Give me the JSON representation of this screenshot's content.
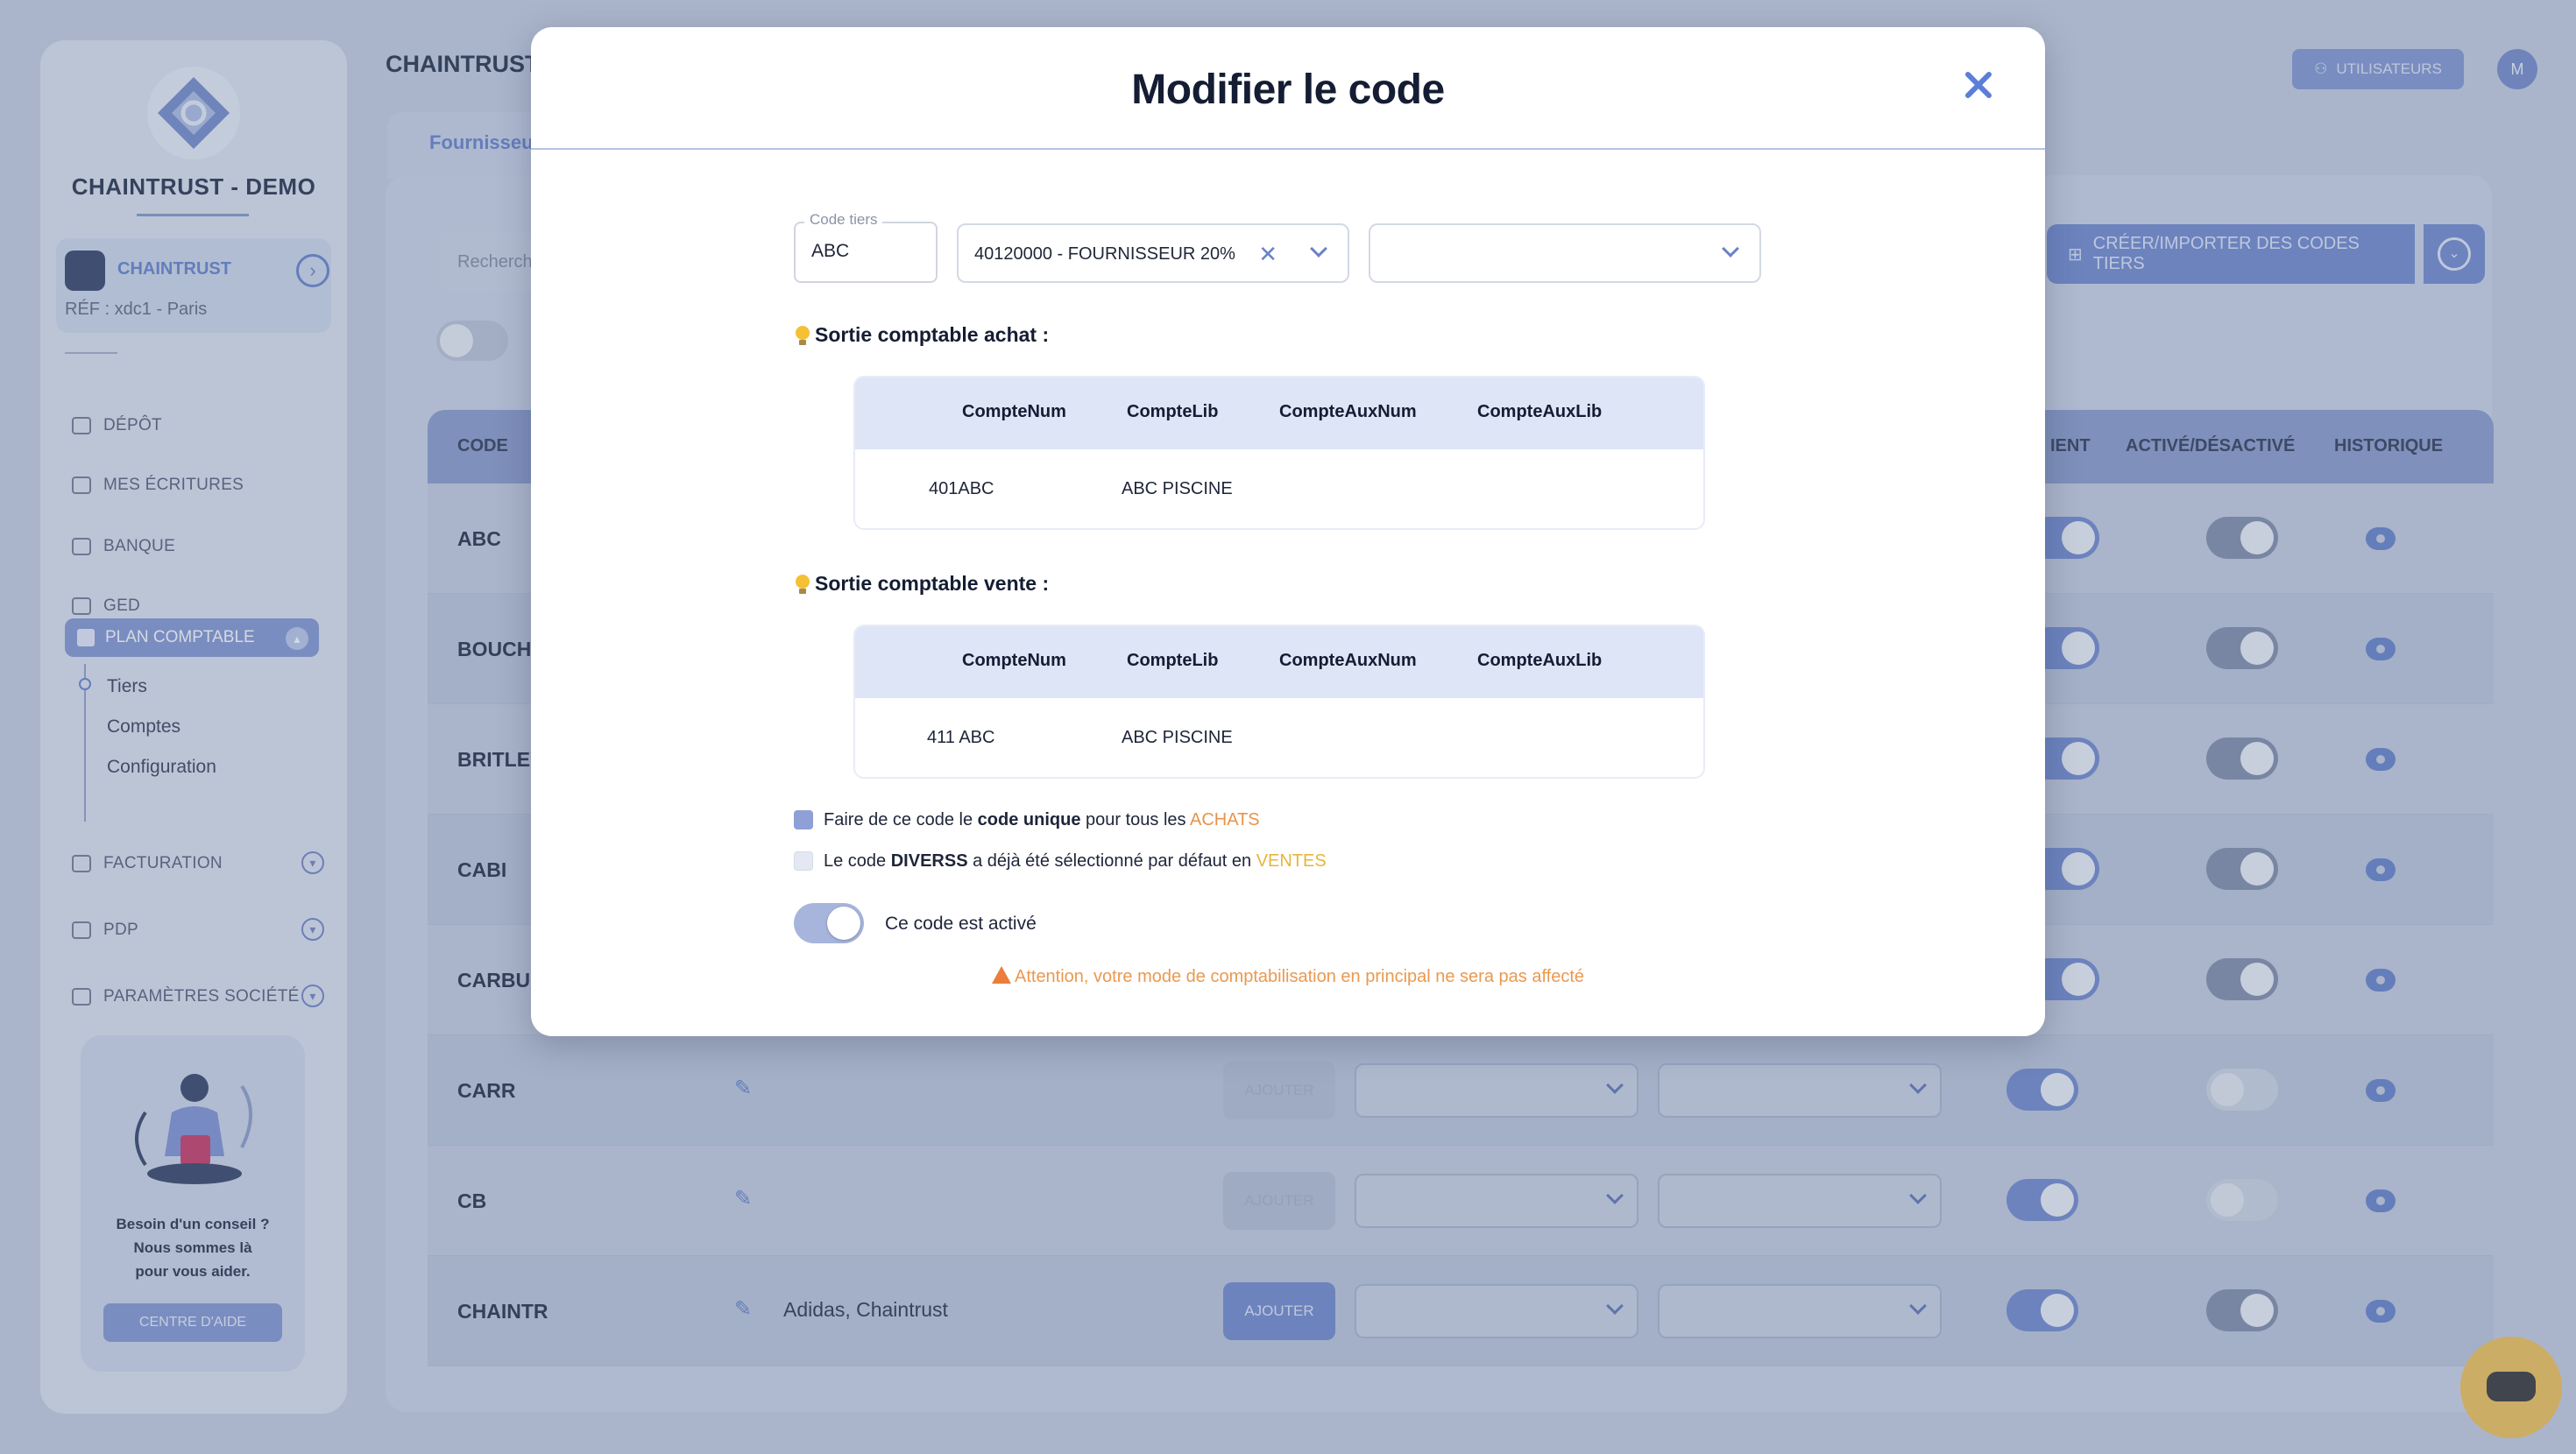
{
  "app": {
    "brand": "CHAINTRUST - DEMO",
    "org_name": "CHAINTRUST",
    "org_ref": "RÉF : xdc1 - Paris",
    "page_title": "CHAINTRUST",
    "top_button": "UTILISATEURS",
    "avatar_initial": "M",
    "tab_label": "Fournisseu",
    "search_placeholder": "Recherch",
    "create_button": "CRÉER/IMPORTER DES CODES TIERS",
    "colors": {
      "accent": "#6b84cc",
      "warning": "#ea9950",
      "achats": "#e8944a",
      "ventes": "#e6b53c"
    }
  },
  "sidebar": {
    "items": [
      {
        "label": "DÉPÔT",
        "icon": "folder-icon"
      },
      {
        "label": "MES ÉCRITURES",
        "icon": "folder-icon"
      },
      {
        "label": "BANQUE",
        "icon": "bank-icon"
      },
      {
        "label": "GED",
        "icon": "document-icon"
      }
    ],
    "active": {
      "label": "PLAN COMPTABLE",
      "icon": "ledger-icon"
    },
    "sub_items": [
      "Tiers",
      "Comptes",
      "Configuration"
    ],
    "more_items": [
      {
        "label": "FACTURATION",
        "icon": "invoice-icon"
      },
      {
        "label": "PDP",
        "icon": "card-icon"
      },
      {
        "label": "PARAMÈTRES SOCIÉTÉ",
        "icon": "sliders-icon"
      }
    ],
    "help_text": [
      "Besoin d'un conseil ?",
      "Nous sommes là",
      "pour vous aider."
    ],
    "help_button": "CENTRE D'AIDE"
  },
  "table": {
    "headers": {
      "code": "CODE",
      "client": "IENT",
      "active": "ACTIVÉ/DÉSACTIVÉ",
      "history": "HISTORIQUE"
    },
    "rows": [
      {
        "code": "ABC"
      },
      {
        "code": "BOUCHE"
      },
      {
        "code": "BRITLEY"
      },
      {
        "code": "CABI"
      },
      {
        "code": "CARBU"
      },
      {
        "code": "CARR",
        "add": "AJOUTER"
      },
      {
        "code": "CB",
        "add": "AJOUTER"
      },
      {
        "code": "CHAINTR",
        "text": "Adidas, Chaintrust",
        "add": "AJOUTER"
      }
    ]
  },
  "modal": {
    "title": "Modifier le code",
    "code_tiers_label": "Code tiers",
    "code_tiers_value": "ABC",
    "account_select": "40120000 - FOURNISSEUR 20%",
    "second_select": "",
    "achat": {
      "title": "Sortie comptable achat :",
      "headers": [
        "CompteNum",
        "CompteLib",
        "CompteAuxNum",
        "CompteAuxLib"
      ],
      "row": [
        "401ABC",
        "ABC PISCINE",
        "",
        ""
      ]
    },
    "vente": {
      "title": "Sortie comptable vente :",
      "headers": [
        "CompteNum",
        "CompteLib",
        "CompteAuxNum",
        "CompteAuxLib"
      ],
      "row": [
        "411 ABC",
        "ABC PISCINE",
        "",
        ""
      ]
    },
    "checkbox1": {
      "a": "Faire de ce code le ",
      "b": "code unique",
      "c": " pour tous les ",
      "d": "ACHATS",
      "checked": true
    },
    "checkbox2": {
      "a": "Le code ",
      "b": "DIVERSS",
      "c": " a déjà été sélectionné par défaut en ",
      "d": "VENTES",
      "checked": false
    },
    "toggle_label": "Ce code est activé",
    "toggle_on": true,
    "warning": "Attention, votre mode de comptabilisation en principal ne sera pas affecté"
  }
}
